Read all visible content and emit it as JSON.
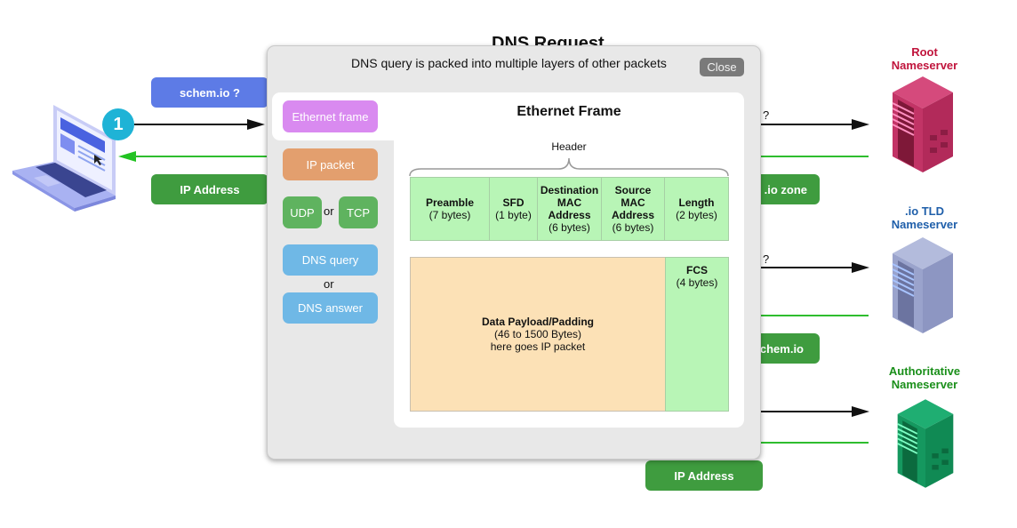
{
  "background_diagram": {
    "title": "DNS Request",
    "client_query_label": "schem.io ?",
    "client_response_label": "IP Address",
    "step_badge": "1",
    "partial_labels": {
      "root_question": "?",
      "root_response": ".io zone",
      "tld_question": "?",
      "tld_response": "chem.io",
      "auth_response": "IP Address"
    },
    "servers": [
      {
        "name": "root",
        "label_line1": "Root",
        "label_line2": "Nameserver",
        "color": "#c0143c"
      },
      {
        "name": "tld",
        "label_line1": ".io TLD",
        "label_line2": "Nameserver",
        "color": "#1f5faa"
      },
      {
        "name": "authoritative",
        "label_line1": "Authoritative",
        "label_line2": "Nameserver",
        "color": "#1a8f1a"
      }
    ],
    "colors": {
      "query_pill": "#5d7be6",
      "response_pill": "#3f9c3f",
      "request_arrow": "#111111",
      "response_arrow": "#2ebd2e",
      "badge": "#1fb3d6"
    }
  },
  "modal": {
    "heading": "DNS query is packed into multiple layers of other packets",
    "close_label": "Close",
    "layers": {
      "ethernet": "Ethernet frame",
      "ip": "IP packet",
      "udp": "UDP",
      "tcp": "TCP",
      "or1": "or",
      "dns_query": "DNS query",
      "or2": "or",
      "dns_answer": "DNS answer"
    },
    "layer_colors": {
      "ethernet": "#d98af0",
      "ip": "#e39f6e",
      "transport": "#5fb35f",
      "dns": "#6fb8e6"
    },
    "frame": {
      "title": "Ethernet Frame",
      "header_label": "Header",
      "header_fields": [
        {
          "name": "Preamble",
          "size": "(7 bytes)"
        },
        {
          "name": "SFD",
          "size": "(1 byte)"
        },
        {
          "name": "Destination MAC Address",
          "line1": "Destination",
          "line2": "MAC",
          "line3": "Address",
          "size": "(6 bytes)"
        },
        {
          "name": "Source MAC Address",
          "line1": "Source",
          "line2": "MAC",
          "line3": "Address",
          "size": "(6 bytes)"
        },
        {
          "name": "Length",
          "size": "(2 bytes)"
        }
      ],
      "payload": {
        "name": "Data Payload/Padding",
        "size": "(46 to 1500 Bytes)",
        "note": "here goes IP packet"
      },
      "fcs": {
        "name": "FCS",
        "size": "(4 bytes)"
      }
    }
  }
}
